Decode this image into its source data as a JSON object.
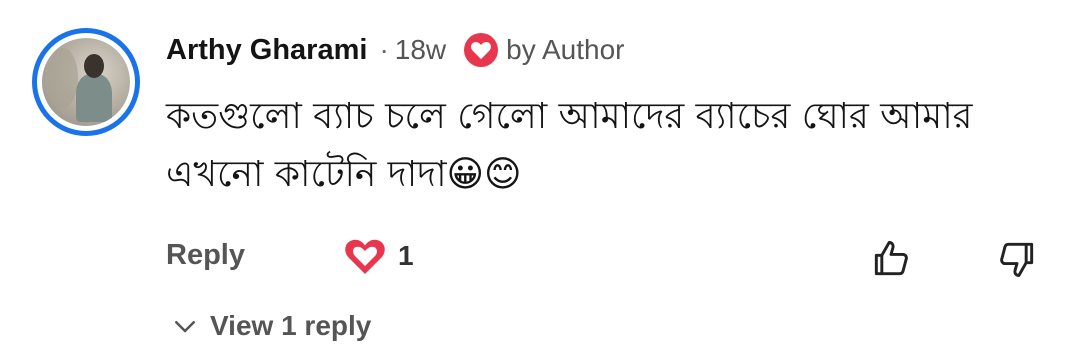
{
  "comment": {
    "author": "Arthy Gharami",
    "separator": "·",
    "time": "18w",
    "badge_text": "by Author",
    "text": "কতগুলো ব্যাচ চলে গেলো আমাদের ব্যাচের ঘোর আমার এখনো কাটেনি দাদা😀😊",
    "reply_label": "Reply",
    "like_count": "1",
    "view_replies": "View 1 reply"
  },
  "colors": {
    "accent": "#1a73e8",
    "heart": "#e8364f",
    "secondary_text": "#555555"
  },
  "icons": {
    "badge": "heart-icon",
    "like": "heart-icon",
    "thumb_up": "thumb-up-icon",
    "thumb_down": "thumb-down-icon",
    "expand": "chevron-down-icon"
  }
}
